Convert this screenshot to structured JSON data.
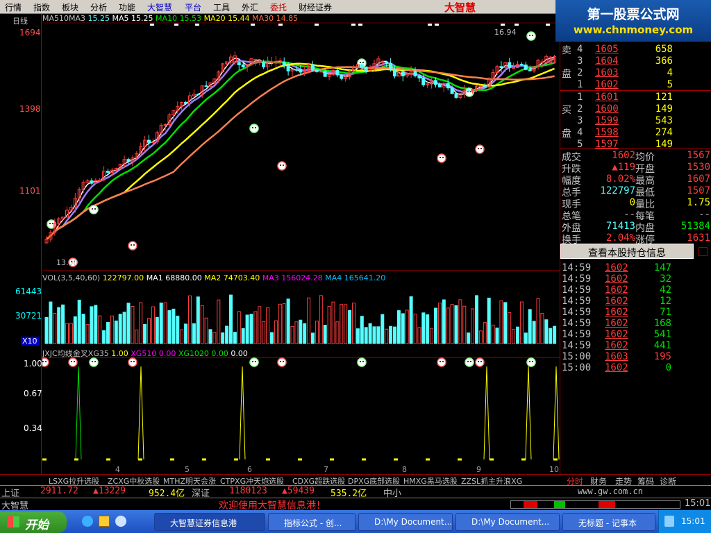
{
  "menu": [
    "行情",
    "指数",
    "板块",
    "分析",
    "功能",
    "大智慧",
    "平台",
    "工具",
    "外汇",
    "委托",
    "财经证券"
  ],
  "logo": "大智慧",
  "brand": {
    "line1": "第一股票公式网",
    "line2": "www.chnmoney.com"
  },
  "chart": {
    "period": "日线",
    "ma_legend": [
      {
        "label": "MA510MA3",
        "value": "15.25",
        "color": "#c0c0c0"
      },
      {
        "label": "MA5",
        "value": "15.25",
        "color": "#ffffff"
      },
      {
        "label": "MA10",
        "value": "15.53",
        "color": "#00e000"
      },
      {
        "label": "MA20",
        "value": "15.44",
        "color": "#ffff00"
      },
      {
        "label": "MA30",
        "value": "14.85",
        "color": "#ff7040"
      }
    ],
    "price_axis": [
      "1694",
      "1398",
      "1101"
    ],
    "high_label": "16.94",
    "low_label": "13.00",
    "vol_legend": [
      {
        "label": "VOL(3,5,40,60)",
        "value": "122797.00",
        "color": "#c0c0c0"
      },
      {
        "label": "MA1",
        "value": "68880.00",
        "color": "#ffffff"
      },
      {
        "label": "MA2",
        "value": "74703.40",
        "color": "#ffff00"
      },
      {
        "label": "MA3",
        "value": "156024.28",
        "color": "#ff00ff"
      },
      {
        "label": "MA4",
        "value": "165641.20",
        "color": "#00c0ff"
      }
    ],
    "vol_axis": [
      "61443",
      "30721",
      "X10"
    ],
    "ind_legend": [
      {
        "label": "JXJC均线金叉XG35",
        "value": "1.00",
        "color": "#c0c0c0"
      },
      {
        "label": "XG510",
        "value": "0.00",
        "color": "#ff00ff"
      },
      {
        "label": "XG1020",
        "value": "0.00",
        "color": "#00e000"
      },
      {
        "label": "",
        "value": "0.00",
        "color": "#ffffff"
      }
    ],
    "ind_axis": [
      "1.00",
      "0.67",
      "0.34"
    ],
    "x_ticks": [
      "4",
      "5",
      "6",
      "7",
      "8",
      "9",
      "10"
    ]
  },
  "quote": {
    "sell_side_label": [
      "卖",
      "盘"
    ],
    "buy_side_label": [
      "买",
      "盘"
    ],
    "sell": [
      {
        "level": "4",
        "price": "1605",
        "vol": "658"
      },
      {
        "level": "3",
        "price": "1604",
        "vol": "366"
      },
      {
        "level": "2",
        "price": "1603",
        "vol": "4"
      },
      {
        "level": "1",
        "price": "1602",
        "vol": "5"
      }
    ],
    "buy": [
      {
        "level": "1",
        "price": "1601",
        "vol": "121"
      },
      {
        "level": "2",
        "price": "1600",
        "vol": "149"
      },
      {
        "level": "3",
        "price": "1599",
        "vol": "543"
      },
      {
        "level": "4",
        "price": "1598",
        "vol": "274"
      },
      {
        "level": "5",
        "price": "1597",
        "vol": "149"
      }
    ],
    "stats": [
      {
        "k1": "成交",
        "v1": "1602",
        "k2": "均价",
        "v2": "1567"
      },
      {
        "k1": "升跌",
        "v1": "▲119",
        "k2": "开盘",
        "v2": "1530"
      },
      {
        "k1": "幅度",
        "v1": "8.02%",
        "k2": "最高",
        "v2": "1607"
      },
      {
        "k1": "总手",
        "v1": "122797",
        "k2": "最低",
        "v2": "1507"
      },
      {
        "k1": "现手",
        "v1": "0",
        "k2": "量比",
        "v2": "1.75"
      },
      {
        "k1": "总笔",
        "v1": "--",
        "k2": "每笔",
        "v2": "--"
      },
      {
        "k1": "外盘",
        "v1": "71413",
        "k2": "内盘",
        "v2": "51384"
      },
      {
        "k1": "换手",
        "v1": "2.04%",
        "k2": "涨停",
        "v2": "1631"
      }
    ],
    "holding_button": "查看本股持仓信息",
    "ticks": [
      {
        "time": "14:59",
        "price": "1602",
        "vol": "147"
      },
      {
        "time": "14:59",
        "price": "1602",
        "vol": "32"
      },
      {
        "time": "14:59",
        "price": "1602",
        "vol": "42"
      },
      {
        "time": "14:59",
        "price": "1602",
        "vol": "12"
      },
      {
        "time": "14:59",
        "price": "1602",
        "vol": "71"
      },
      {
        "time": "14:59",
        "price": "1602",
        "vol": "168"
      },
      {
        "time": "14:59",
        "price": "1602",
        "vol": "541"
      },
      {
        "time": "14:59",
        "price": "1602",
        "vol": "441"
      },
      {
        "time": "15:00",
        "price": "1603",
        "vol": "195"
      },
      {
        "time": "15:00",
        "price": "1602",
        "vol": "0"
      }
    ]
  },
  "tabs": [
    "LSXG拉升选股",
    "ZCXG中秋选股",
    "MTHZ明天会涨",
    "CTPXG冲天炮选股",
    "CDXG超跌选股",
    "DPXG底部选股",
    "HMXG黑马选股",
    "ZZSL抓主升浪XG"
  ],
  "side_tabs": [
    "分时",
    "财务",
    "走势",
    "筹码",
    "诊断"
  ],
  "ticker": {
    "sh_label": "上证",
    "sh_value": "2911.72",
    "sh_change": "▲13229",
    "sh_amount": "952.4亿",
    "sz_label": "深证",
    "sz_value": "1180123",
    "sz_change": "▲59439",
    "sz_amount": "535.2亿",
    "zx_label": "中小",
    "site": "www.gw.com.cn"
  },
  "status": {
    "app": "大智慧",
    "welcome": "欢迎使用大智慧信息港！",
    "clock": "15:01"
  },
  "taskbar": {
    "start": "开始",
    "items": [
      "大智慧证券信息港",
      "指标公式 - 创...",
      "D:\\My Document...",
      "D:\\My Document...",
      "无标题 - 记事本"
    ],
    "active_index": 0,
    "time": "15:01"
  },
  "colors": {
    "up": "#ff3c3c",
    "down": "#54ffff",
    "panel_border": "#a00000"
  }
}
